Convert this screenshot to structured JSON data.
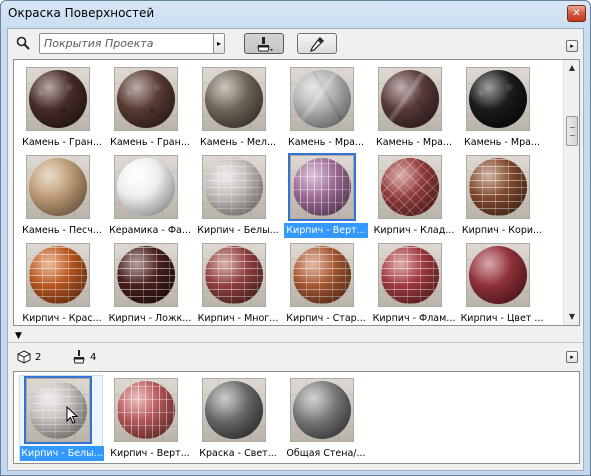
{
  "window": {
    "title": "Окраска Поверхностей",
    "close_glyph": "✕"
  },
  "toolbar": {
    "search_placeholder": "Покрытия Проекта",
    "dropdown_glyph": "▸",
    "menu_glyph": "▸"
  },
  "materials": [
    {
      "label": "Камень - Гран...",
      "base": "#5a3a35",
      "dark": "#2a1815",
      "pattern": "granite"
    },
    {
      "label": "Камень - Гран...",
      "base": "#6a4a40",
      "dark": "#3a2520",
      "pattern": "granite"
    },
    {
      "label": "Камень - Мел...",
      "base": "#8a7e6e",
      "dark": "#4a4238",
      "pattern": "plain"
    },
    {
      "label": "Камень - Мра...",
      "base": "#c8c8c8",
      "dark": "#8e8e8e",
      "pattern": "marble"
    },
    {
      "label": "Камень - Мра...",
      "base": "#6e4a4a",
      "dark": "#3a2222",
      "pattern": "marble"
    },
    {
      "label": "Камень - Мра...",
      "base": "#2a2a2a",
      "dark": "#050505",
      "pattern": "granite"
    },
    {
      "label": "Камень - Песч...",
      "base": "#d2b08a",
      "dark": "#9a7a58",
      "pattern": "plain"
    },
    {
      "label": "Керамика - Фа...",
      "base": "#ffffff",
      "dark": "#cfcfcf",
      "pattern": "plain"
    },
    {
      "label": "Кирпич - Белы...",
      "base": "#d8d2d0",
      "dark": "#9a9492",
      "pattern": "brick"
    },
    {
      "label": "Кирпич - Верт...",
      "base": "#b07fa8",
      "dark": "#7a4a74",
      "pattern": "vbrick"
    },
    {
      "label": "Кирпич - Клад...",
      "base": "#a84a48",
      "dark": "#6a2422",
      "pattern": "herringbone"
    },
    {
      "label": "Кирпич - Кори...",
      "base": "#9a5a3a",
      "dark": "#5a301a",
      "pattern": "brick"
    },
    {
      "label": "Кирпич - Крас...",
      "base": "#d46a2a",
      "dark": "#8a3a10",
      "pattern": "brick"
    },
    {
      "label": "Кирпич - Ложк...",
      "base": "#5a2a28",
      "dark": "#2a0e0c",
      "pattern": "brick"
    },
    {
      "label": "Кирпич - Мног...",
      "base": "#a85050",
      "dark": "#6a2828",
      "pattern": "brick"
    },
    {
      "label": "Кирпич - Стар...",
      "base": "#c06a40",
      "dark": "#7a3a1c",
      "pattern": "brick"
    },
    {
      "label": "Кирпич - Флам...",
      "base": "#b84a50",
      "dark": "#7a2228",
      "pattern": "brick"
    },
    {
      "label": "Кирпич - Цвет ...",
      "base": "#a8404a",
      "dark": "#6a1c24",
      "pattern": "plain"
    }
  ],
  "selected_index": 9,
  "counts": {
    "objects": "2",
    "surfaces": "4"
  },
  "project_materials": [
    {
      "label": "Кирпич - Белы...",
      "base": "#dcd6d4",
      "dark": "#9a9492",
      "pattern": "brick"
    },
    {
      "label": "Кирпич - Верт...",
      "base": "#d07070",
      "dark": "#8a3434",
      "pattern": "vbrick"
    },
    {
      "label": "Краска - Свет...",
      "base": "#8a8a8a",
      "dark": "#3a3a3a",
      "pattern": "plain"
    },
    {
      "label": "Общая Стена/...",
      "base": "#9a9a9a",
      "dark": "#4a4a4a",
      "pattern": "plain"
    }
  ],
  "project_selected_index": 0,
  "scrollbar": {
    "up_glyph": "▲",
    "down_glyph": "▼"
  },
  "collapse_glyph": "▼"
}
